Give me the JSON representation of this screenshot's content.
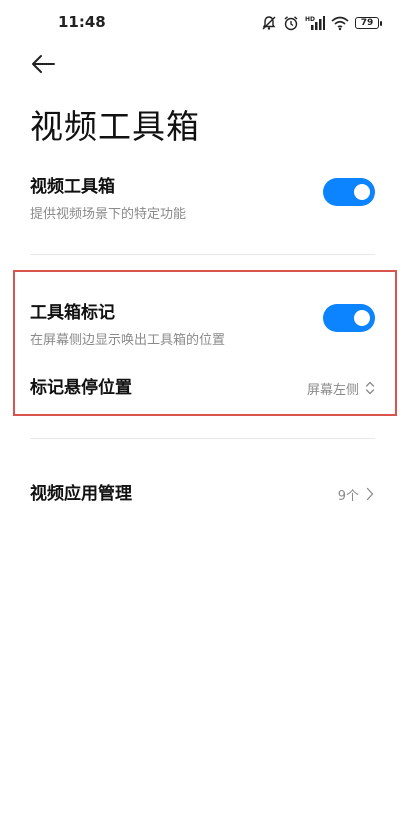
{
  "status_bar": {
    "time": "11:48",
    "battery": "79",
    "icons": [
      "notifications-off-icon",
      "alarm-icon",
      "hd-signal-icon",
      "wifi-icon",
      "battery-icon"
    ]
  },
  "header": {
    "back_icon": "arrow-left-icon",
    "title": "视频工具箱"
  },
  "settings": {
    "video_toolbox": {
      "title": "视频工具箱",
      "subtitle": "提供视频场景下的特定功能",
      "enabled": true
    },
    "toolbox_marker": {
      "title": "工具箱标记",
      "subtitle": "在屏幕侧边显示唤出工具箱的位置",
      "enabled": true
    },
    "marker_position": {
      "title": "标记悬停位置",
      "value": "屏幕左侧"
    },
    "video_app_management": {
      "title": "视频应用管理",
      "value": "9个"
    }
  },
  "colors": {
    "accent": "#0d84ff",
    "highlight": "#d9534f",
    "subtitle": "#8a8a8a"
  }
}
